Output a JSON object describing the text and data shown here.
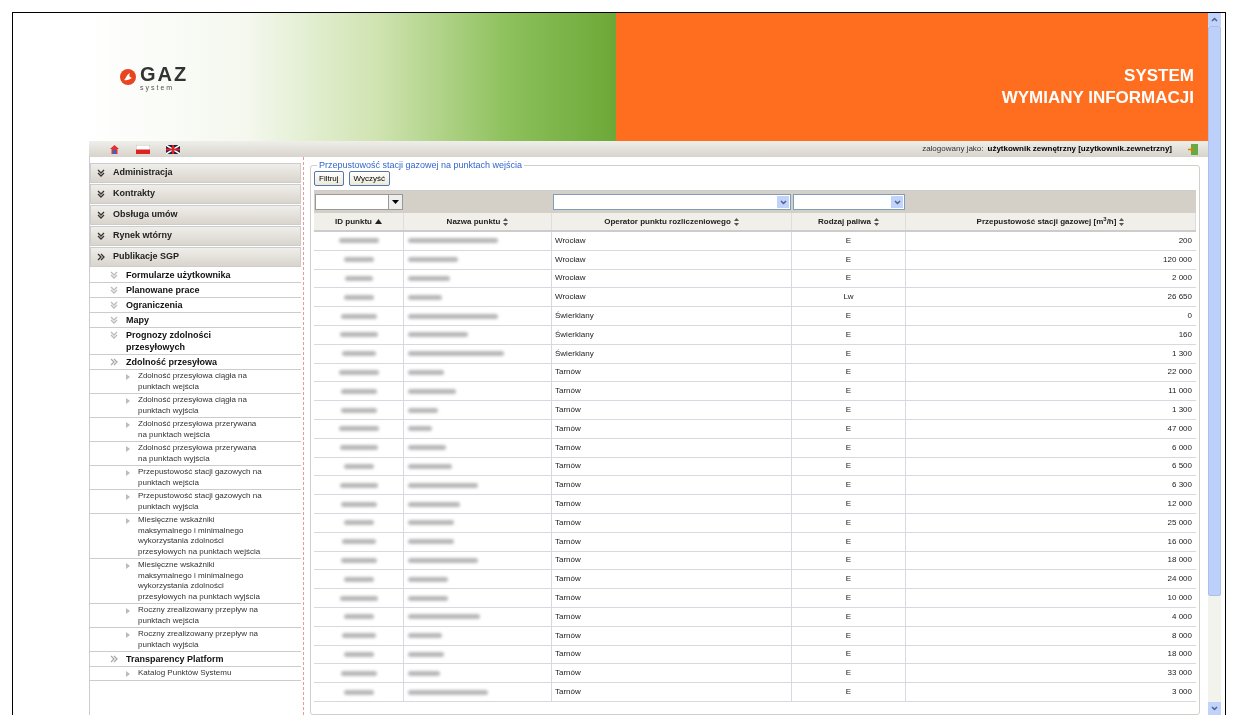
{
  "header": {
    "logo": {
      "mark": "GAZ",
      "sub": "system"
    },
    "title_lines": [
      "SYSTEM",
      "WYMIANY INFORMACJI"
    ]
  },
  "toolbar": {
    "login_label": "zalogowany jako:",
    "login_user": "użytkownik zewnętrzny [uzytkownik.zewnetrzny]"
  },
  "sidebar": {
    "items": [
      {
        "label": "Administracja",
        "expanded": false
      },
      {
        "label": "Kontrakty",
        "expanded": false
      },
      {
        "label": "Obsługa umów",
        "expanded": false
      },
      {
        "label": "Rynek wtórny",
        "expanded": false
      },
      {
        "label": "Publikacje SGP",
        "expanded": true,
        "children": [
          {
            "label": "Formularze użytkownika",
            "expanded": false
          },
          {
            "label": "Planowane prace",
            "expanded": false
          },
          {
            "label": "Ograniczenia",
            "expanded": false
          },
          {
            "label": "Mapy",
            "expanded": false
          },
          {
            "label": "Prognozy zdolności przesyłowych",
            "expanded": false
          },
          {
            "label": "Zdolność przesyłowa",
            "expanded": true,
            "children": [
              {
                "label": "Zdolność przesyłowa ciągła na punktach wejścia"
              },
              {
                "label": "Zdolność przesyłowa ciągła na punktach wyjścia"
              },
              {
                "label": "Zdolność przesyłowa przerywana na punktach wejścia"
              },
              {
                "label": "Zdolność przesyłowa przerywana na punktach wyjścia"
              },
              {
                "label": "Przepustowość stacji gazowych na punktach wejścia"
              },
              {
                "label": "Przepustowość stacji gazowych na punktach wyjścia"
              },
              {
                "label": "Miesięczne wskaźniki maksymalnego i minimalnego wykorzystania zdolności przesyłowych na punktach wejścia"
              },
              {
                "label": "Miesięczne wskaźniki maksymalnego i minimalnego wykorzystania zdolności przesyłowych na punktach wyjścia"
              },
              {
                "label": "Roczny zrealizowany przepływ na punktach wejścia"
              },
              {
                "label": "Roczny zrealizowany przepływ na punktach wyjścia"
              }
            ]
          },
          {
            "label": "Transparency Platform",
            "expanded": true,
            "children": [
              {
                "label": "Katalog Punktów Systemu"
              }
            ]
          }
        ]
      }
    ]
  },
  "panel": {
    "legend": "Przepustowość stacji gazowej na punktach wejścia",
    "buttons": [
      "Filtruj",
      "Wyczyść"
    ]
  },
  "table": {
    "columns": [
      {
        "label": "ID punktu",
        "sorted": true,
        "kind": "combo"
      },
      {
        "label": "Nazwa punktu",
        "sorted": false,
        "kind": "plain"
      },
      {
        "label": "Operator punktu rozliczeniowego",
        "sorted": false,
        "kind": "select"
      },
      {
        "label": "Rodzaj paliwa",
        "sorted": false,
        "kind": "select"
      },
      {
        "label": "Przepustowość stacji gazowej [m$^{3}$/h]",
        "sorted": false,
        "kind": "plain"
      }
    ],
    "rows": [
      {
        "operator": "Wrocław",
        "fuel": "E",
        "capacity": "200"
      },
      {
        "operator": "Wrocław",
        "fuel": "E",
        "capacity": "120 000"
      },
      {
        "operator": "Wrocław",
        "fuel": "E",
        "capacity": "2 000"
      },
      {
        "operator": "Wrocław",
        "fuel": "Lw",
        "capacity": "26 650"
      },
      {
        "operator": "Świerklany",
        "fuel": "E",
        "capacity": "0"
      },
      {
        "operator": "Świerklany",
        "fuel": "E",
        "capacity": "160"
      },
      {
        "operator": "Świerklany",
        "fuel": "E",
        "capacity": "1 300"
      },
      {
        "operator": "Tarnów",
        "fuel": "E",
        "capacity": "22 000"
      },
      {
        "operator": "Tarnów",
        "fuel": "E",
        "capacity": "11 000"
      },
      {
        "operator": "Tarnów",
        "fuel": "E",
        "capacity": "1 300"
      },
      {
        "operator": "Tarnów",
        "fuel": "E",
        "capacity": "47 000"
      },
      {
        "operator": "Tarnów",
        "fuel": "E",
        "capacity": "6 000"
      },
      {
        "operator": "Tarnów",
        "fuel": "E",
        "capacity": "6 500"
      },
      {
        "operator": "Tarnów",
        "fuel": "E",
        "capacity": "6 300"
      },
      {
        "operator": "Tarnów",
        "fuel": "E",
        "capacity": "12 000"
      },
      {
        "operator": "Tarnów",
        "fuel": "E",
        "capacity": "25 000"
      },
      {
        "operator": "Tarnów",
        "fuel": "E",
        "capacity": "16 000"
      },
      {
        "operator": "Tarnów",
        "fuel": "E",
        "capacity": "18 000"
      },
      {
        "operator": "Tarnów",
        "fuel": "E",
        "capacity": "24 000"
      },
      {
        "operator": "Tarnów",
        "fuel": "E",
        "capacity": "10 000"
      },
      {
        "operator": "Tarnów",
        "fuel": "E",
        "capacity": "4 000"
      },
      {
        "operator": "Tarnów",
        "fuel": "E",
        "capacity": "8 000"
      },
      {
        "operator": "Tarnów",
        "fuel": "E",
        "capacity": "18 000"
      },
      {
        "operator": "Tarnów",
        "fuel": "E",
        "capacity": "33 000"
      },
      {
        "operator": "Tarnów",
        "fuel": "E",
        "capacity": "3 000"
      }
    ]
  }
}
